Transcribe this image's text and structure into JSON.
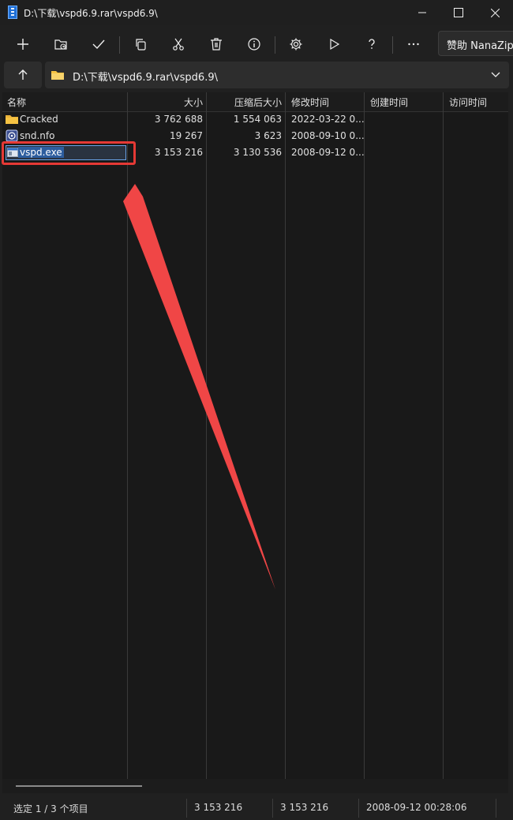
{
  "window": {
    "title": "D:\\下载\\vspd6.9.rar\\vspd6.9\\"
  },
  "toolbar": {
    "buttons": [
      "add-icon",
      "extract-folder-icon",
      "test-check-icon",
      "copy-icon",
      "cut-scissors-icon",
      "delete-icon",
      "info-icon",
      "settings-gear-icon",
      "run-play-icon",
      "help-question-icon",
      "more-icon"
    ],
    "sponsor_label": "赞助 NanaZip"
  },
  "address": {
    "path": "D:\\下载\\vspd6.9.rar\\vspd6.9\\"
  },
  "columns": {
    "name": "名称",
    "size": "大小",
    "packed": "压缩后大小",
    "modified": "修改时间",
    "created": "创建时间",
    "accessed": "访问时间"
  },
  "files": [
    {
      "name": "Cracked",
      "size": "3 762 688",
      "packed": "1 554 063",
      "modified": "2022-03-22 0...",
      "icon": "folder-icon"
    },
    {
      "name": "snd.nfo",
      "size": "19 267",
      "packed": "3 623",
      "modified": "2008-09-10 0...",
      "icon": "nfo-file-icon"
    },
    {
      "name": "vspd.exe",
      "size": "3 153 216",
      "packed": "3 130 536",
      "modified": "2008-09-12 0...",
      "icon": "exe-file-icon"
    }
  ],
  "status": {
    "selection": "选定 1 / 3 个项目",
    "size": "3 153 216",
    "packed": "3 153 216",
    "modified": "2008-09-12 00:28:06"
  },
  "colors": {
    "highlight_box": "#e53935",
    "arrow": "#f04646",
    "folder": "#f6c343"
  }
}
